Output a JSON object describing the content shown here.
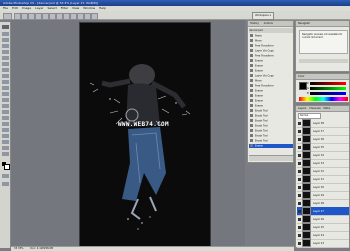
{
  "window": {
    "title": "Adobe Photoshop CS - [dancer.psd @ 33.3% (Layer 27, RGB/8)]"
  },
  "menu": [
    "File",
    "Edit",
    "Image",
    "Layer",
    "Select",
    "Filter",
    "View",
    "Window",
    "Help"
  ],
  "options": {
    "workspace_button": "Workspace ▾"
  },
  "history": {
    "tabs": [
      "History",
      "Actions"
    ],
    "doc_name": "dancer.psd",
    "items": [
      "Paste",
      "Move",
      "Free Transform",
      "Layer Via Copy",
      "Free Transform",
      "Eraser",
      "Eraser",
      "Eraser",
      "Layer Via Copy",
      "Move",
      "Free Transform",
      "Eraser",
      "Eraser",
      "Eraser",
      "Eraser",
      "Brush Tool",
      "Brush Tool",
      "Brush Tool",
      "Brush Tool",
      "Brush Tool",
      "Brush Tool",
      "Brush Tool",
      "Eraser"
    ]
  },
  "actions": {
    "title": "Navigator",
    "note": "Navigator preview not available for current document"
  },
  "color": {
    "title": "Color",
    "channels": [
      "R",
      "G",
      "B"
    ]
  },
  "layers": {
    "tabs": [
      "Layers",
      "Channels",
      "Paths"
    ],
    "mode": "Normal",
    "items": [
      "Layer 38",
      "Layer 37",
      "Layer 36",
      "Layer 35",
      "Layer 34",
      "Layer 33",
      "Layer 32",
      "Layer 31",
      "Layer 30",
      "Layer 29",
      "Layer 28",
      "Layer 27",
      "Layer 26",
      "Layer 25",
      "Layer 24",
      "Layer 23"
    ]
  },
  "canvas": {
    "watermark": "WWW.WEB74.COM"
  },
  "status": {
    "zoom": "33.33%",
    "doc": "Doc: 4.12M/98.6M"
  },
  "colors": {
    "selection": "#1f56c8",
    "canvas_bg": "#74787e",
    "titlebar": "#2f5fb8"
  }
}
